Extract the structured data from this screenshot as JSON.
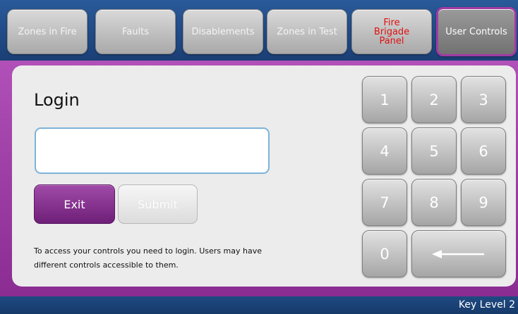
{
  "tabs": [
    {
      "label": "Zones in Fire"
    },
    {
      "label": "Faults"
    },
    {
      "label": "Disablements"
    },
    {
      "label": "Zones in Test"
    },
    {
      "label_lines": [
        "Fire",
        "Brigade",
        "Panel"
      ]
    },
    {
      "label": "User Controls",
      "active": true
    }
  ],
  "login": {
    "title": "Login",
    "input_value": "",
    "exit_label": "Exit",
    "submit_label": "Submit",
    "hint": "To access your controls you need to login. Users may have different controls accessible to them."
  },
  "keypad": {
    "keys": [
      "1",
      "2",
      "3",
      "4",
      "5",
      "6",
      "7",
      "8",
      "9",
      "0"
    ],
    "backspace_icon": "left-arrow-icon"
  },
  "status": {
    "key_level": "Key Level 2"
  },
  "colors": {
    "accent_purple": "#8a2c92",
    "fire_red": "#e01010",
    "header_blue": "#1a3e74"
  }
}
